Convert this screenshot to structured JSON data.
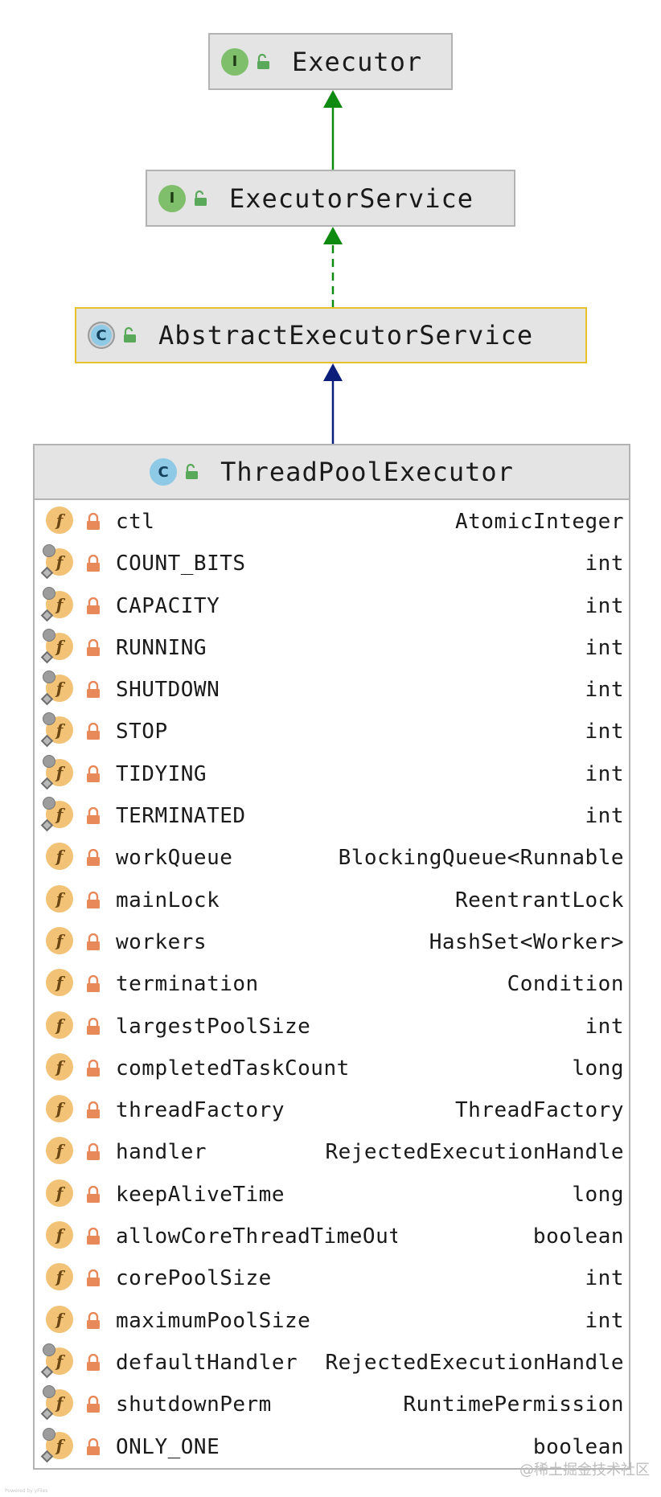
{
  "colors": {
    "extends_arrow": "#0f8a10",
    "implements_arrow": "#0f8a10",
    "class_extends_arrow": "#0b1f7a",
    "selected_border": "#e9c12a",
    "field_badge": "#f2c276",
    "lock": "#e8895a"
  },
  "icons": {
    "interface": "I",
    "class": "C",
    "field": "f"
  },
  "nodes": {
    "executor": {
      "name": "Executor",
      "kind": "interface"
    },
    "executor_service": {
      "name": "ExecutorService",
      "kind": "interface"
    },
    "abstract_executor_service": {
      "name": "AbstractExecutorService",
      "kind": "abstract-class"
    },
    "thread_pool_executor": {
      "name": "ThreadPoolExecutor",
      "kind": "class"
    }
  },
  "fields": [
    {
      "name": "ctl",
      "type": "AtomicInteger",
      "static": false,
      "final": false
    },
    {
      "name": "COUNT_BITS",
      "type": "int",
      "static": true,
      "final": true
    },
    {
      "name": "CAPACITY",
      "type": "int",
      "static": true,
      "final": true
    },
    {
      "name": "RUNNING",
      "type": "int",
      "static": true,
      "final": true
    },
    {
      "name": "SHUTDOWN",
      "type": "int",
      "static": true,
      "final": true
    },
    {
      "name": "STOP",
      "type": "int",
      "static": true,
      "final": true
    },
    {
      "name": "TIDYING",
      "type": "int",
      "static": true,
      "final": true
    },
    {
      "name": "TERMINATED",
      "type": "int",
      "static": true,
      "final": true
    },
    {
      "name": "workQueue",
      "type": "BlockingQueue<Runnable",
      "static": false,
      "final": false
    },
    {
      "name": "mainLock",
      "type": "ReentrantLock",
      "static": false,
      "final": false
    },
    {
      "name": "workers",
      "type": "HashSet<Worker>",
      "static": false,
      "final": false
    },
    {
      "name": "termination",
      "type": "Condition",
      "static": false,
      "final": false
    },
    {
      "name": "largestPoolSize",
      "type": "int",
      "static": false,
      "final": false
    },
    {
      "name": "completedTaskCount",
      "type": "long",
      "static": false,
      "final": false
    },
    {
      "name": "threadFactory",
      "type": "ThreadFactory",
      "static": false,
      "final": false
    },
    {
      "name": "handler",
      "type": "RejectedExecutionHandle",
      "static": false,
      "final": false
    },
    {
      "name": "keepAliveTime",
      "type": "long",
      "static": false,
      "final": false
    },
    {
      "name": "allowCoreThreadTimeOut",
      "type": "boolean",
      "static": false,
      "final": false
    },
    {
      "name": "corePoolSize",
      "type": "int",
      "static": false,
      "final": false
    },
    {
      "name": "maximumPoolSize",
      "type": "int",
      "static": false,
      "final": false
    },
    {
      "name": "defaultHandler",
      "type": "RejectedExecutionHandle",
      "static": true,
      "final": true
    },
    {
      "name": "shutdownPerm",
      "type": "RuntimePermission",
      "static": true,
      "final": true
    },
    {
      "name": "ONLY_ONE",
      "type": "boolean",
      "static": true,
      "final": true
    }
  ],
  "watermark": "@稀土掘金技术社区",
  "footnote": "Powered by yFiles"
}
